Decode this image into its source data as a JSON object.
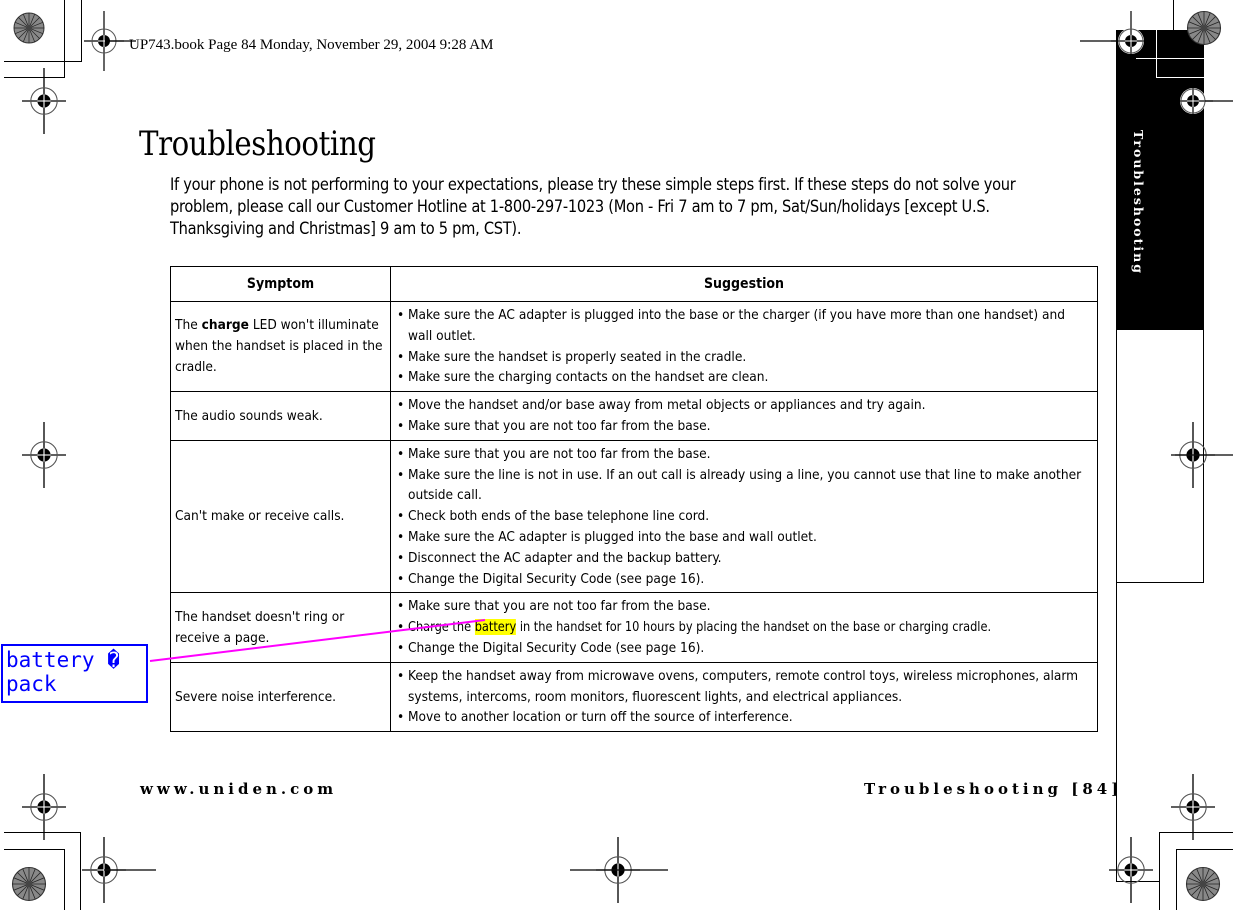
{
  "book_header": "UP743.book  Page 84  Monday, November 29, 2004  9:28 AM",
  "page": {
    "title": "Troubleshooting",
    "intro": "If your phone is not performing to your expectations, please try these simple steps first. If these steps do not solve your problem, please call our Customer Hotline at 1-800-297-1023 (Mon - Fri 7 am to 7 pm, Sat/Sun/holidays [except U.S. Thanksgiving and Christmas] 9 am to 5 pm, CST)."
  },
  "side_tab": {
    "label": "Troubleshooting"
  },
  "table": {
    "headers": {
      "symptom": "Symptom",
      "suggestion": "Suggestion"
    },
    "rows": [
      {
        "symptom_pre": "The ",
        "symptom_bold": "charge",
        "symptom_post": " LED won't illuminate when the handset is placed in the cradle.",
        "suggestions": [
          "Make sure the AC adapter is plugged into the base or the charger (if you have more than one handset) and wall outlet.",
          "Make sure the handset is properly seated in the cradle.",
          "Make sure the charging contacts on the handset are clean."
        ]
      },
      {
        "symptom": "The audio sounds weak.",
        "suggestions": [
          "Move the handset and/or base away from metal objects or appliances and try again.",
          "Make sure that you are not too far from the base."
        ]
      },
      {
        "symptom": "Can't make or receive calls.",
        "suggestions": [
          "Make sure that you are not too far from the base.",
          "Make sure the line is not in use. If an out call is already using a line, you cannot use that line to make another outside call.",
          "Check both ends of the base telephone line cord.",
          "Make sure the AC adapter is plugged into the base and wall outlet.",
          "Disconnect the AC adapter and the backup battery.",
          "Change the Digital Security Code (see page 16)."
        ]
      },
      {
        "symptom": "The handset doesn't ring or receive a page.",
        "suggestions": [
          "Make sure that you are not too far from the base.",
          "Change the Digital Security Code (see page 16)."
        ],
        "highlight_suggestion": {
          "pre": "Charge the ",
          "highlight": "battery",
          "post": " in the handset for 10 hours by placing the handset on the base or charging cradle."
        }
      },
      {
        "symptom": "Severe noise interference.",
        "suggestions": [
          "Keep the handset away from microwave ovens, computers, remote control toys, wireless microphones, alarm systems, intercoms, room monitors, fluorescent lights, and electrical appliances.",
          "Move to another location or turn off the source of interference."
        ]
      }
    ]
  },
  "annotation": {
    "text": "battery � pack",
    "line1": "battery �",
    "line2": "pack",
    "box_color": "#0000ff",
    "connector_color": "#ff00ff",
    "highlight_color": "#ffff00"
  },
  "footer": {
    "left": "www.uniden.com",
    "right": "Troubleshooting [84]"
  },
  "marks": {
    "registration_icon": "registration-crosshair-icon",
    "color_wheel_icon": "color-wheel-icon"
  }
}
